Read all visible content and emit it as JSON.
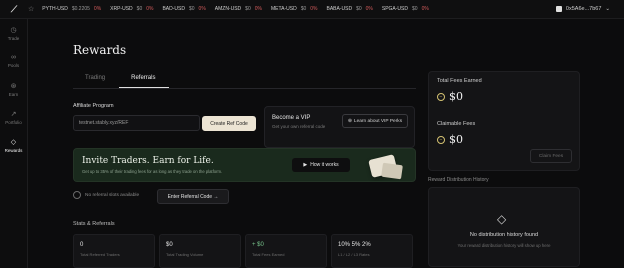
{
  "topbar": {
    "tickers": [
      {
        "symbol": "PYTH-USD",
        "price": "$0.2205",
        "change": "0%"
      },
      {
        "symbol": "XRP-USD",
        "price": "$0",
        "change": "0%"
      },
      {
        "symbol": "BAD-USD",
        "price": "$0",
        "change": "0%"
      },
      {
        "symbol": "AMZN-USD",
        "price": "$0",
        "change": "0%"
      },
      {
        "symbol": "META-USD",
        "price": "$0",
        "change": "0%"
      },
      {
        "symbol": "BABA-USD",
        "price": "$0",
        "change": "0%"
      },
      {
        "symbol": "SPGA-USD",
        "price": "$0",
        "change": "0%"
      }
    ],
    "account": "0x5A6e...7b67"
  },
  "sidebar": {
    "items": [
      {
        "label": "Trade",
        "icon": "clock-icon"
      },
      {
        "label": "Pools",
        "icon": "pools-icon"
      },
      {
        "label": "Earn",
        "icon": "earn-icon"
      },
      {
        "label": "Portfolio",
        "icon": "portfolio-icon"
      },
      {
        "label": "Rewards",
        "icon": "diamond-icon"
      }
    ]
  },
  "page": {
    "title": "Rewards",
    "tabs": [
      "Trading",
      "Referrals"
    ]
  },
  "affiliate": {
    "label": "Affiliate Program",
    "link": "testnet.stably.xyz/REF",
    "create_button": "Create Ref Code"
  },
  "vip": {
    "title": "Become a VIP",
    "subtitle": "Get your own referral code",
    "button": "Learn about VIP Perks"
  },
  "banner": {
    "title": "Invite Traders. Earn for Life.",
    "subtitle": "Get up to 35% of their trading fees for as long as they trade on the platform.",
    "button": "How it works"
  },
  "referral": {
    "slots_text": "No referral slots available",
    "enter_button": "Enter Referral Code →"
  },
  "stats": {
    "heading": "Stats & Referrals",
    "cards": [
      {
        "value": "0",
        "label": "Total Referred Traders",
        "green": false
      },
      {
        "value": "$0",
        "label": "Total Trading Volume",
        "green": false
      },
      {
        "value": "+ $0",
        "label": "Total Fees Earned",
        "green": true
      },
      {
        "value": "10% 5% 2%",
        "label": "L1 / L2 / L3 Rates",
        "green": false
      }
    ]
  },
  "fees": {
    "total_label": "Total Fees Earned",
    "total_value": "$0",
    "claimable_label": "Claimable Fees",
    "claimable_value": "$0",
    "claim_button": "Claim Fees"
  },
  "distribution": {
    "heading": "Reward Distribution History",
    "empty_title": "No distribution history found",
    "empty_subtitle": "Your reward distribution history will show up here"
  }
}
